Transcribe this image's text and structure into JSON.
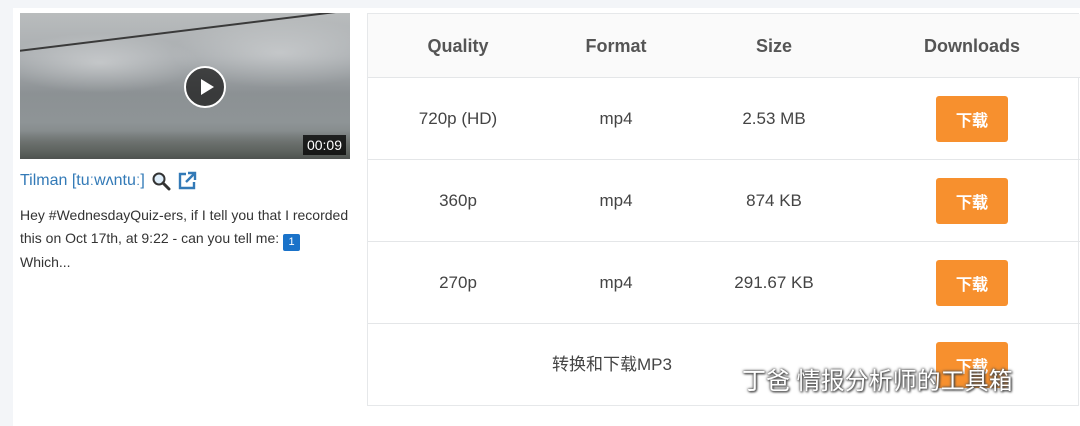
{
  "video": {
    "duration": "00:09",
    "title": "Tilman [tuːwʌntuː]",
    "description_before_badge": "Hey #WednesdayQuiz-ers, if I tell you that I recorded this on Oct 17th, at 9:22 - can you tell me: ",
    "badge": "1",
    "description_after_badge": " Which..."
  },
  "table": {
    "headers": {
      "quality": "Quality",
      "format": "Format",
      "size": "Size",
      "downloads": "Downloads"
    },
    "rows": [
      {
        "quality": "720p (HD)",
        "format": "mp4",
        "size": "2.53 MB",
        "button": "下载"
      },
      {
        "quality": "360p",
        "format": "mp4",
        "size": "874 KB",
        "button": "下载"
      },
      {
        "quality": "270p",
        "format": "mp4",
        "size": "291.67 KB",
        "button": "下载"
      }
    ],
    "mp3": {
      "label": "转换和下载MP3",
      "button": "下载"
    }
  },
  "watermark": {
    "text": "丁爸 情报分析师的工具箱"
  },
  "colors": {
    "accent": "#f7902e",
    "link": "#337ab7",
    "badge": "#1a72c9"
  }
}
